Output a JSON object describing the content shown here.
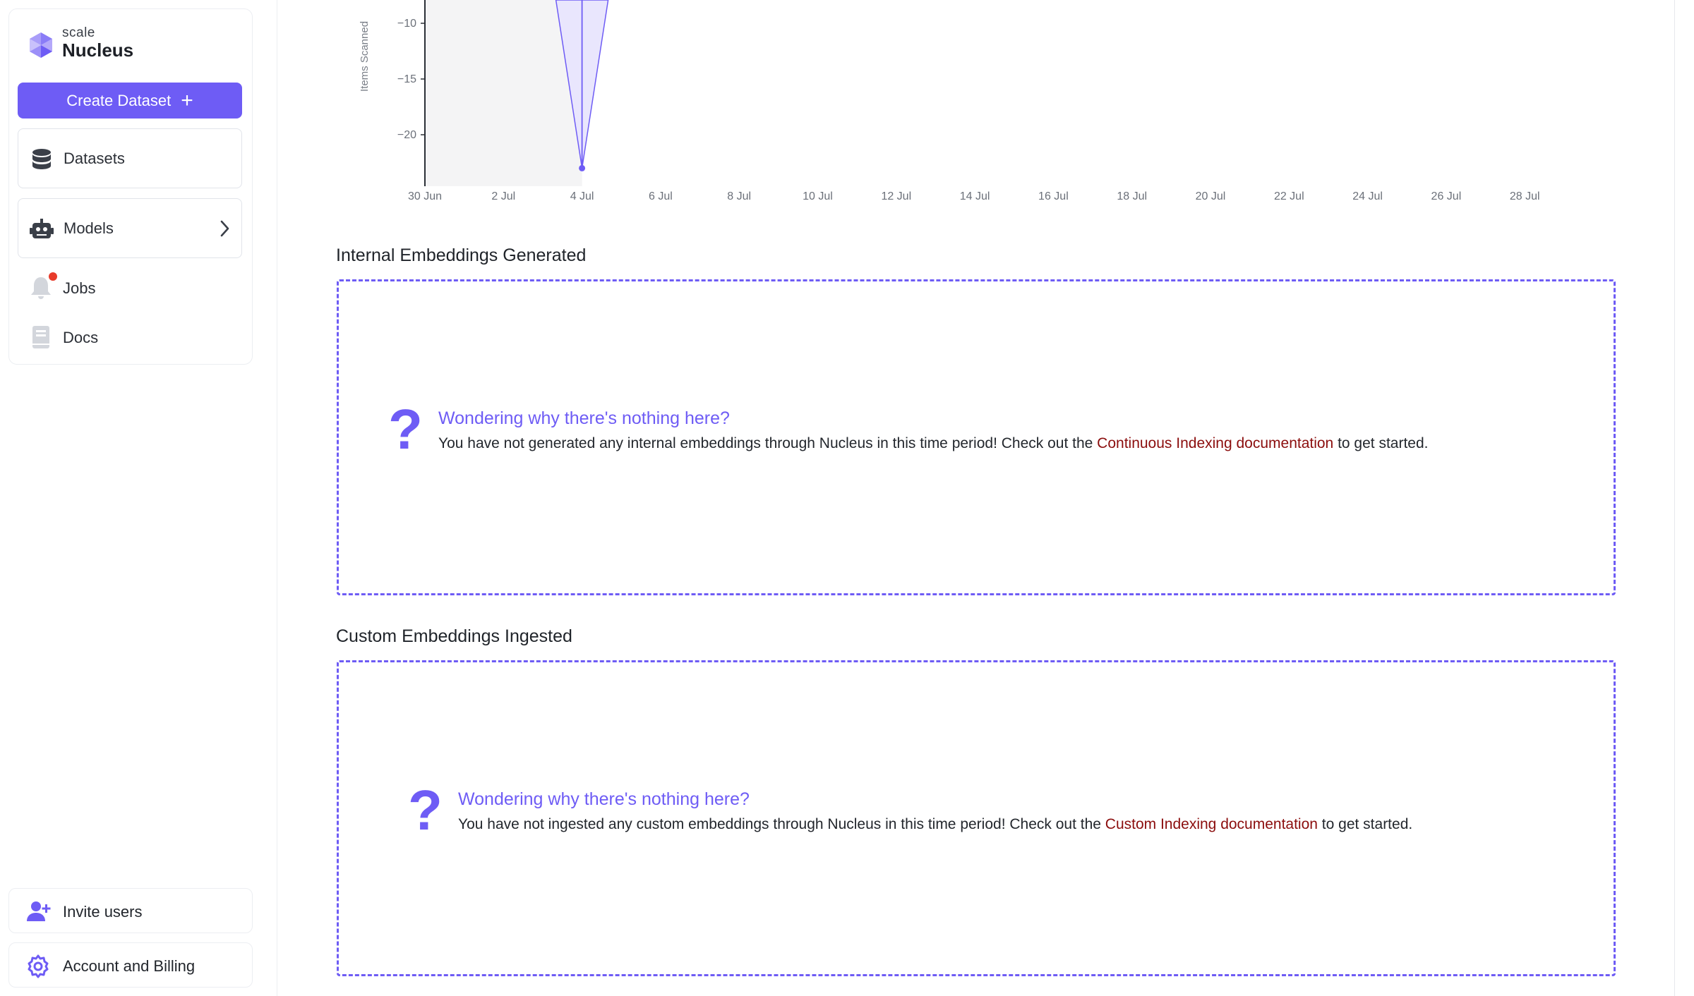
{
  "sidebar": {
    "logo": {
      "brand": "scale",
      "product": "Nucleus"
    },
    "create_button": "Create Dataset",
    "nav": [
      {
        "label": "Datasets",
        "icon": "database-icon"
      },
      {
        "label": "Models",
        "icon": "robot-icon"
      },
      {
        "label": "Jobs",
        "icon": "bell-icon",
        "has_notification": true
      },
      {
        "label": "Docs",
        "icon": "book-icon"
      }
    ],
    "bottom": [
      {
        "label": "Invite users",
        "icon": "add-user-icon"
      },
      {
        "label": "Account and Billing",
        "icon": "gear-icon"
      }
    ]
  },
  "chart_data": {
    "type": "line",
    "ylabel": "Items Scanned",
    "y_ticks": [
      "−10",
      "−15",
      "−20"
    ],
    "x_ticks": [
      "30 Jun",
      "2 Jul",
      "4 Jul",
      "6 Jul",
      "8 Jul",
      "10 Jul",
      "12 Jul",
      "14 Jul",
      "16 Jul",
      "18 Jul",
      "20 Jul",
      "22 Jul",
      "24 Jul",
      "26 Jul",
      "28 Jul"
    ],
    "series": [
      {
        "x": [
          "4 Jul"
        ],
        "y": [
          -23
        ]
      }
    ],
    "shaded_range": [
      "30 Jun",
      "4 Jul"
    ],
    "colors": {
      "line": "#6e5cf5",
      "fill": "#e9e6fd",
      "shade": "#f4f4f5"
    }
  },
  "sections": [
    {
      "title": "Internal Embeddings Generated",
      "heading": "Wondering why there's nothing here?",
      "body_before": "You have not generated any internal embeddings through Nucleus in this time period! Check out the ",
      "link": "Continuous Indexing documentation",
      "body_after": " to get started."
    },
    {
      "title": "Custom Embeddings Ingested",
      "heading": "Wondering why there's nothing here?",
      "body_before": "You have not ingested any custom embeddings through Nucleus in this time period! Check out the ",
      "link": "Custom Indexing documentation",
      "body_after": " to get started."
    }
  ],
  "theme": {
    "accent": "#6e5cf5",
    "link": "#8b0d0d",
    "notification": "#e83b2b"
  }
}
